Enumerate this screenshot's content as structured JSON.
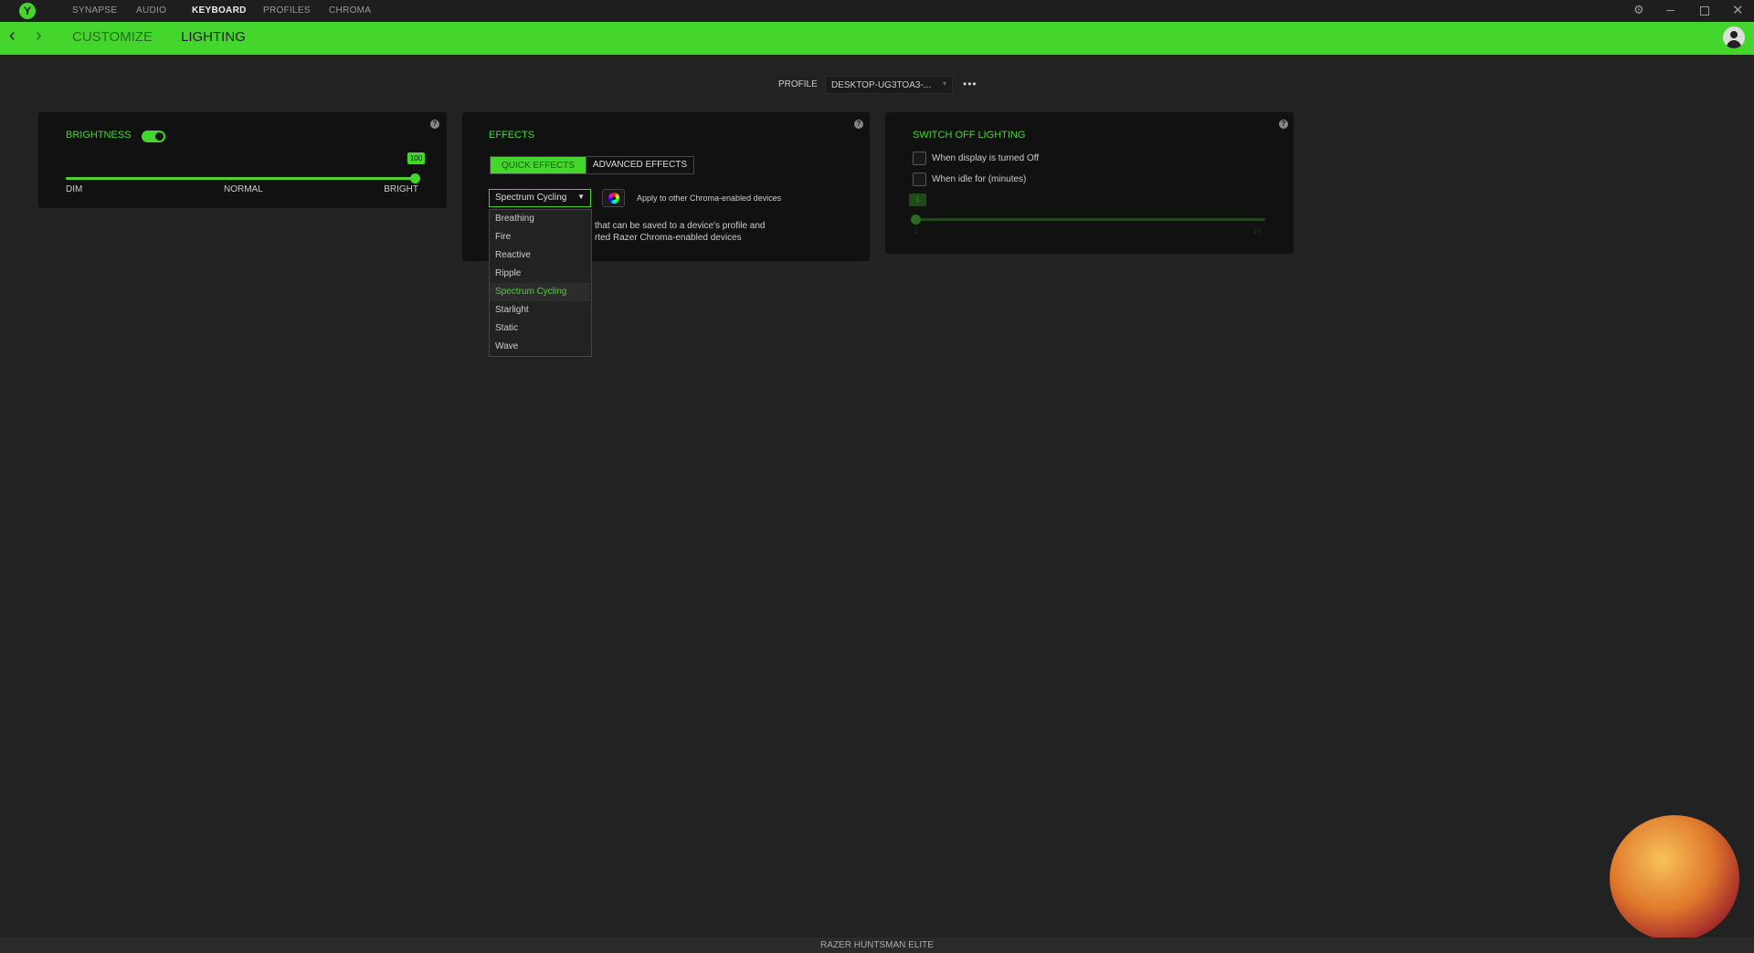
{
  "titlebar": {
    "tabs": [
      "SYNAPSE",
      "AUDIO",
      "KEYBOARD",
      "PROFILES",
      "CHROMA"
    ],
    "active": "KEYBOARD"
  },
  "subnav": {
    "items": [
      "CUSTOMIZE",
      "LIGHTING"
    ],
    "active": "LIGHTING"
  },
  "profile": {
    "label": "PROFILE",
    "value": "DESKTOP-UG3TOA3-..."
  },
  "brightness": {
    "title": "BRIGHTNESS",
    "enabled": true,
    "value": "100",
    "percent": 100,
    "labels": [
      "DIM",
      "NORMAL",
      "BRIGHT"
    ]
  },
  "effects": {
    "title": "EFFECTS",
    "tabs": [
      "QUICK EFFECTS",
      "ADVANCED EFFECTS"
    ],
    "selected": "Spectrum Cycling",
    "apply_label": "Apply to other Chroma-enabled devices",
    "desc_lines": [
      "that can be saved to a device's profile and",
      "rted Razer Chroma-enabled devices"
    ],
    "options": [
      "Breathing",
      "Fire",
      "Reactive",
      "Ripple",
      "Spectrum Cycling",
      "Starlight",
      "Static",
      "Wave"
    ]
  },
  "switch_off": {
    "title": "SWITCH OFF LIGHTING",
    "display_off": "When display is turned Off",
    "idle": "When idle for (minutes)",
    "idle_value": "1",
    "min": "1",
    "max": "15"
  },
  "status": {
    "device": "RAZER HUNTSMAN ELITE"
  },
  "colors": {
    "accent": "#44d62c",
    "panel": "#111111",
    "background": "#222222"
  }
}
